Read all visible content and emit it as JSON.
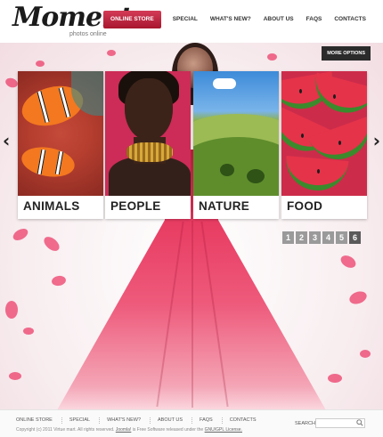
{
  "logo": {
    "title": "Moment",
    "subtitle": "photos online"
  },
  "nav": [
    {
      "label": "ONLINE STORE",
      "active": true
    },
    {
      "label": "SPECIAL"
    },
    {
      "label": "WHAT'S NEW?"
    },
    {
      "label": "ABOUT US"
    },
    {
      "label": "FAQS"
    },
    {
      "label": "CONTACTS"
    }
  ],
  "hero": {
    "more_options": "MORE OPTIONS"
  },
  "categories": [
    {
      "label": "ANIMALS"
    },
    {
      "label": "PEOPLE"
    },
    {
      "label": "NATURE"
    },
    {
      "label": "FOOD"
    }
  ],
  "pager": {
    "pages": [
      "1",
      "2",
      "3",
      "4",
      "5",
      "6"
    ],
    "current": "6"
  },
  "footer": {
    "links": [
      "ONLINE STORE",
      "SPECIAL",
      "WHAT'S NEW?",
      "ABOUT US",
      "FAQS",
      "CONTACTS"
    ],
    "copyright_pre": "Copyright (c) 2011 Virtue mart. All rights reserved.",
    "joomla": "Joomla!",
    "copyright_mid": "is Free Software released under the",
    "license": "GNU/GPL License.",
    "search_label": "SEARCH:",
    "search_value": ""
  },
  "colors": {
    "accent": "#c62140",
    "petal": "#ec3d6a"
  }
}
